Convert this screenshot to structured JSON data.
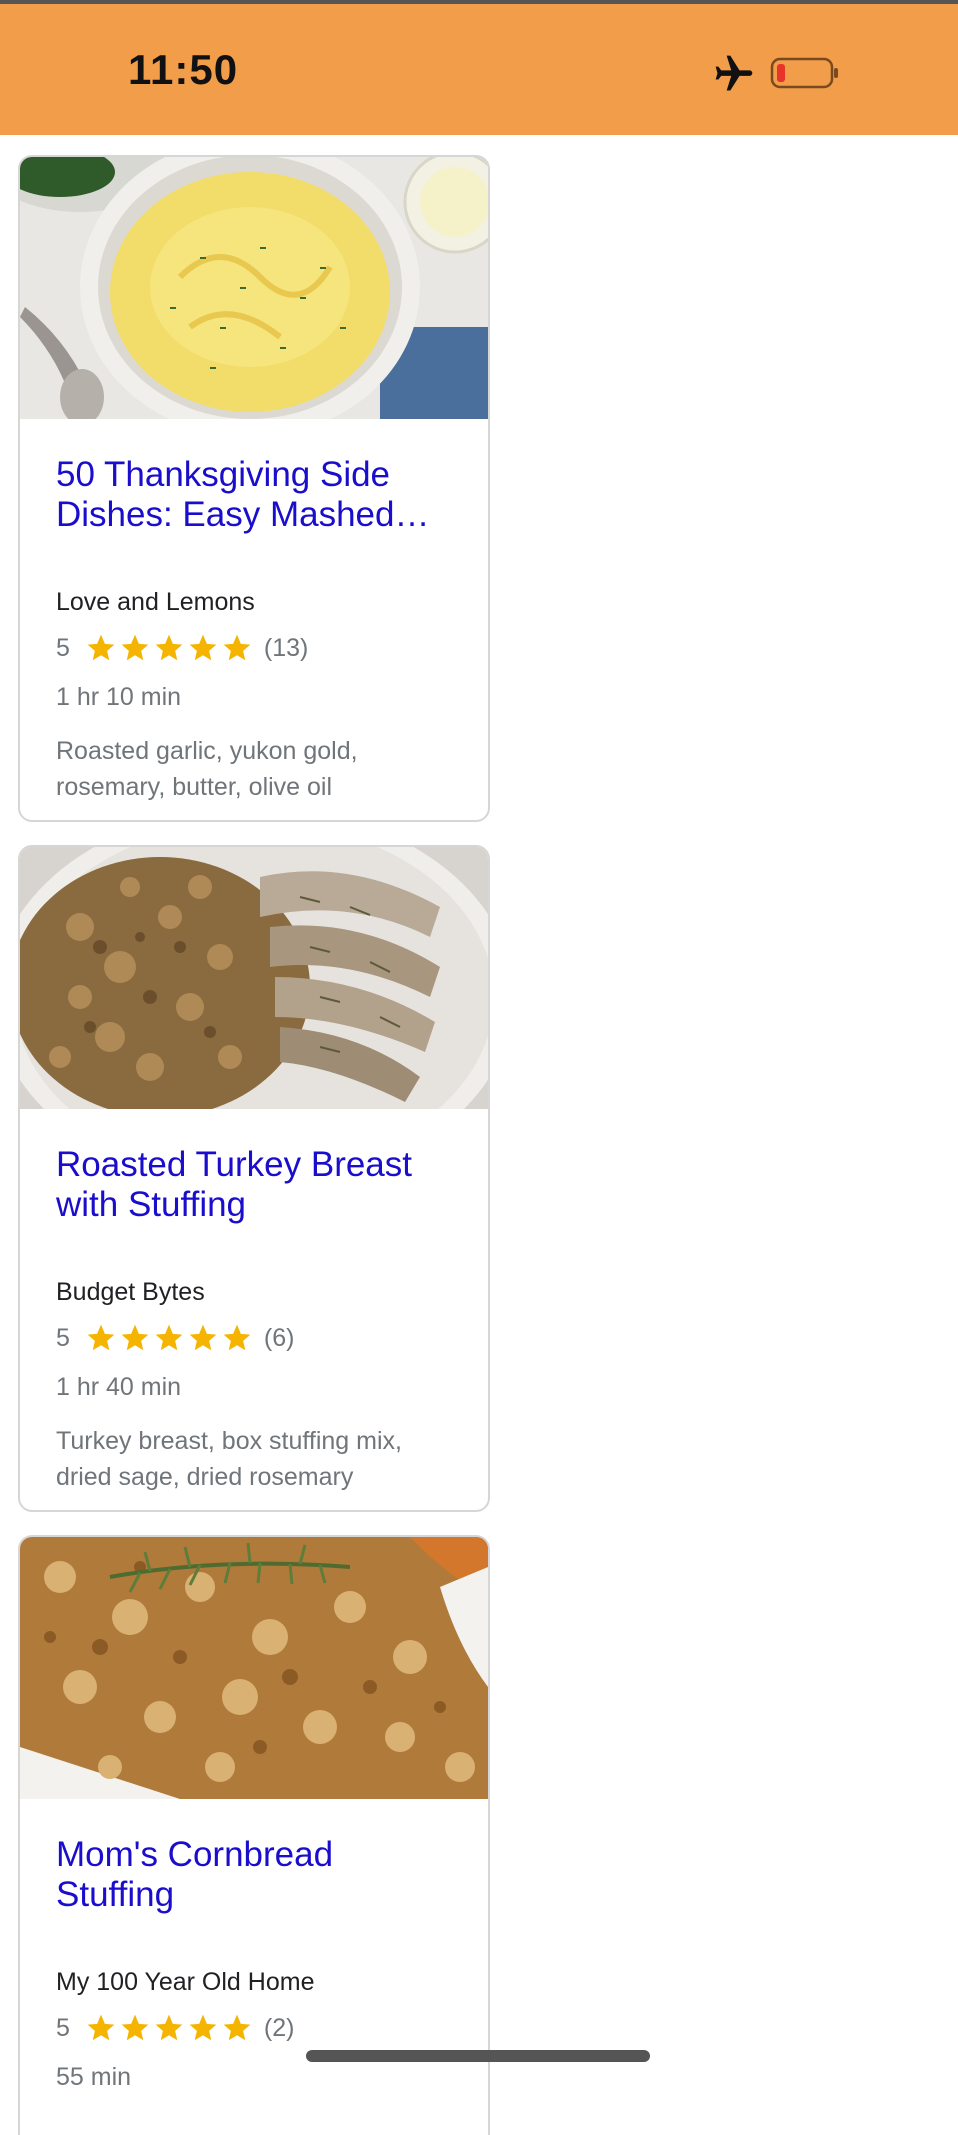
{
  "status_bar": {
    "time": "11:50",
    "background_color": "#f19d4a",
    "icons": [
      "airplane-icon",
      "battery-low-icon"
    ]
  },
  "recipes": [
    {
      "title": "50 Thanksgiving Side Dishes: Easy Mashed…",
      "source": "Love and Lemons",
      "rating": "5",
      "rating_value": 5,
      "reviews": "(13)",
      "time": "1 hr 10 min",
      "ingredients": "Roasted garlic, yukon gold, rosemary, butter, olive oil",
      "image": "mashed-potatoes-photo"
    },
    {
      "title": "Roasted Turkey Breast with Stuffing",
      "source": "Budget Bytes",
      "rating": "5",
      "rating_value": 5,
      "reviews": "(6)",
      "time": "1 hr 40 min",
      "ingredients": "Turkey breast, box stuffing mix, dried sage, dried rosemary",
      "image": "turkey-stuffing-photo"
    },
    {
      "title": "Mom's Cornbread Stuffing",
      "source": "My 100 Year Old Home",
      "rating": "5",
      "rating_value": 5,
      "reviews": "(2)",
      "time": "55 min",
      "ingredients": "",
      "image": "cornbread-stuffing-photo"
    }
  ],
  "colors": {
    "title_link": "#1a0dcc",
    "star": "#f4b400",
    "muted_text": "#70757a"
  }
}
